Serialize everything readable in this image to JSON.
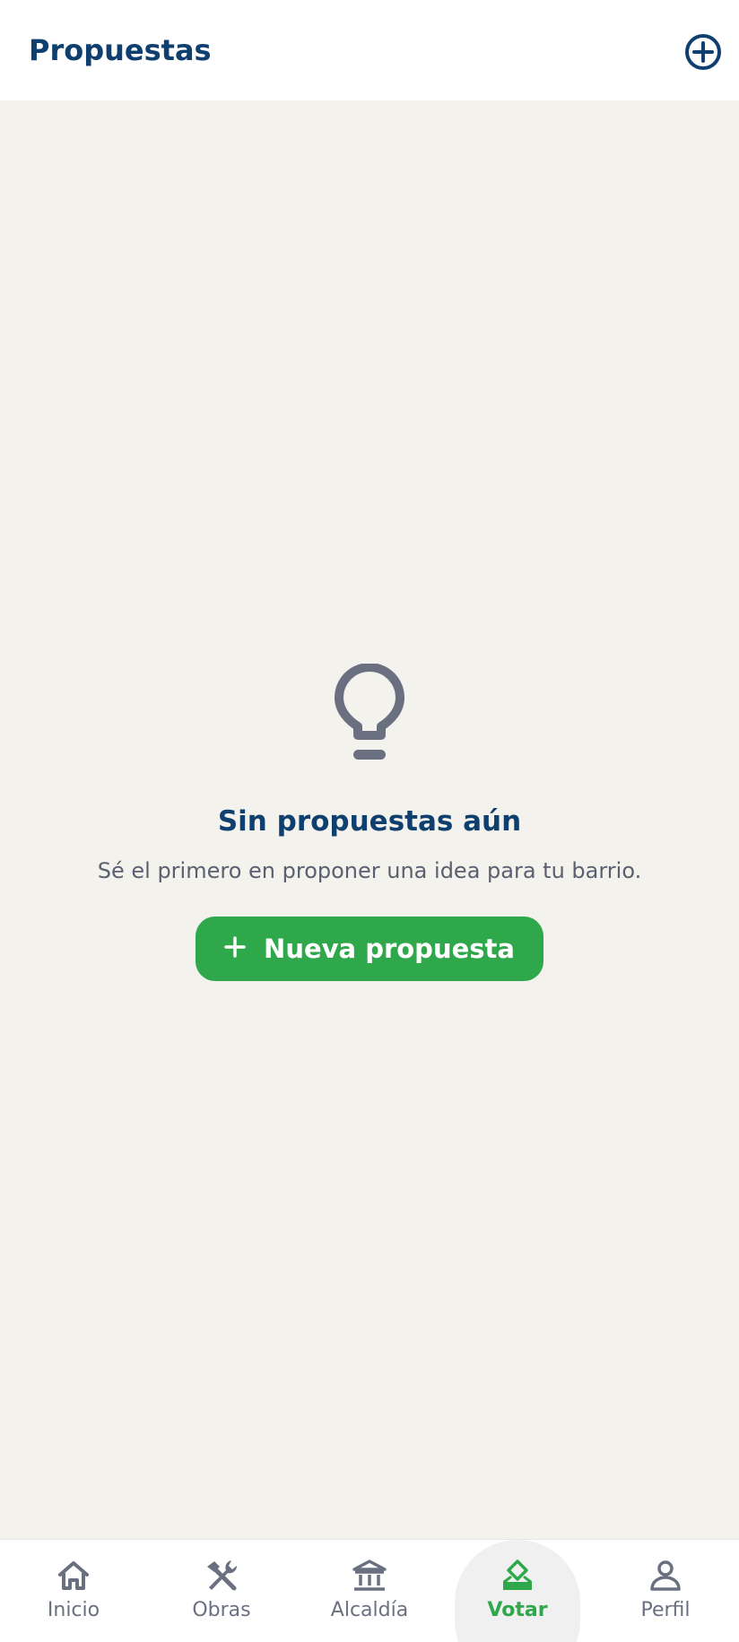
{
  "header": {
    "title": "Propuestas",
    "add_icon": "plus-circle-icon"
  },
  "empty_state": {
    "icon": "lightbulb-icon",
    "title": "Sin propuestas aún",
    "subtitle": "Sé el primero en proponer una idea para tu barrio.",
    "button_label": "Nueva propuesta",
    "button_icon": "plus-icon"
  },
  "bottom_nav": {
    "items": [
      {
        "label": "Inicio",
        "icon": "home-icon",
        "active": false
      },
      {
        "label": "Obras",
        "icon": "tools-icon",
        "active": false
      },
      {
        "label": "Alcaldía",
        "icon": "bank-icon",
        "active": false
      },
      {
        "label": "Votar",
        "icon": "vote-icon",
        "active": true
      },
      {
        "label": "Perfil",
        "icon": "user-icon",
        "active": false
      }
    ]
  },
  "colors": {
    "brand_navy": "#0f3f6e",
    "accent_green": "#2ea84a",
    "background": "#f3f2ed",
    "muted_text": "#5a6070",
    "icon_gray": "#6b7080"
  }
}
